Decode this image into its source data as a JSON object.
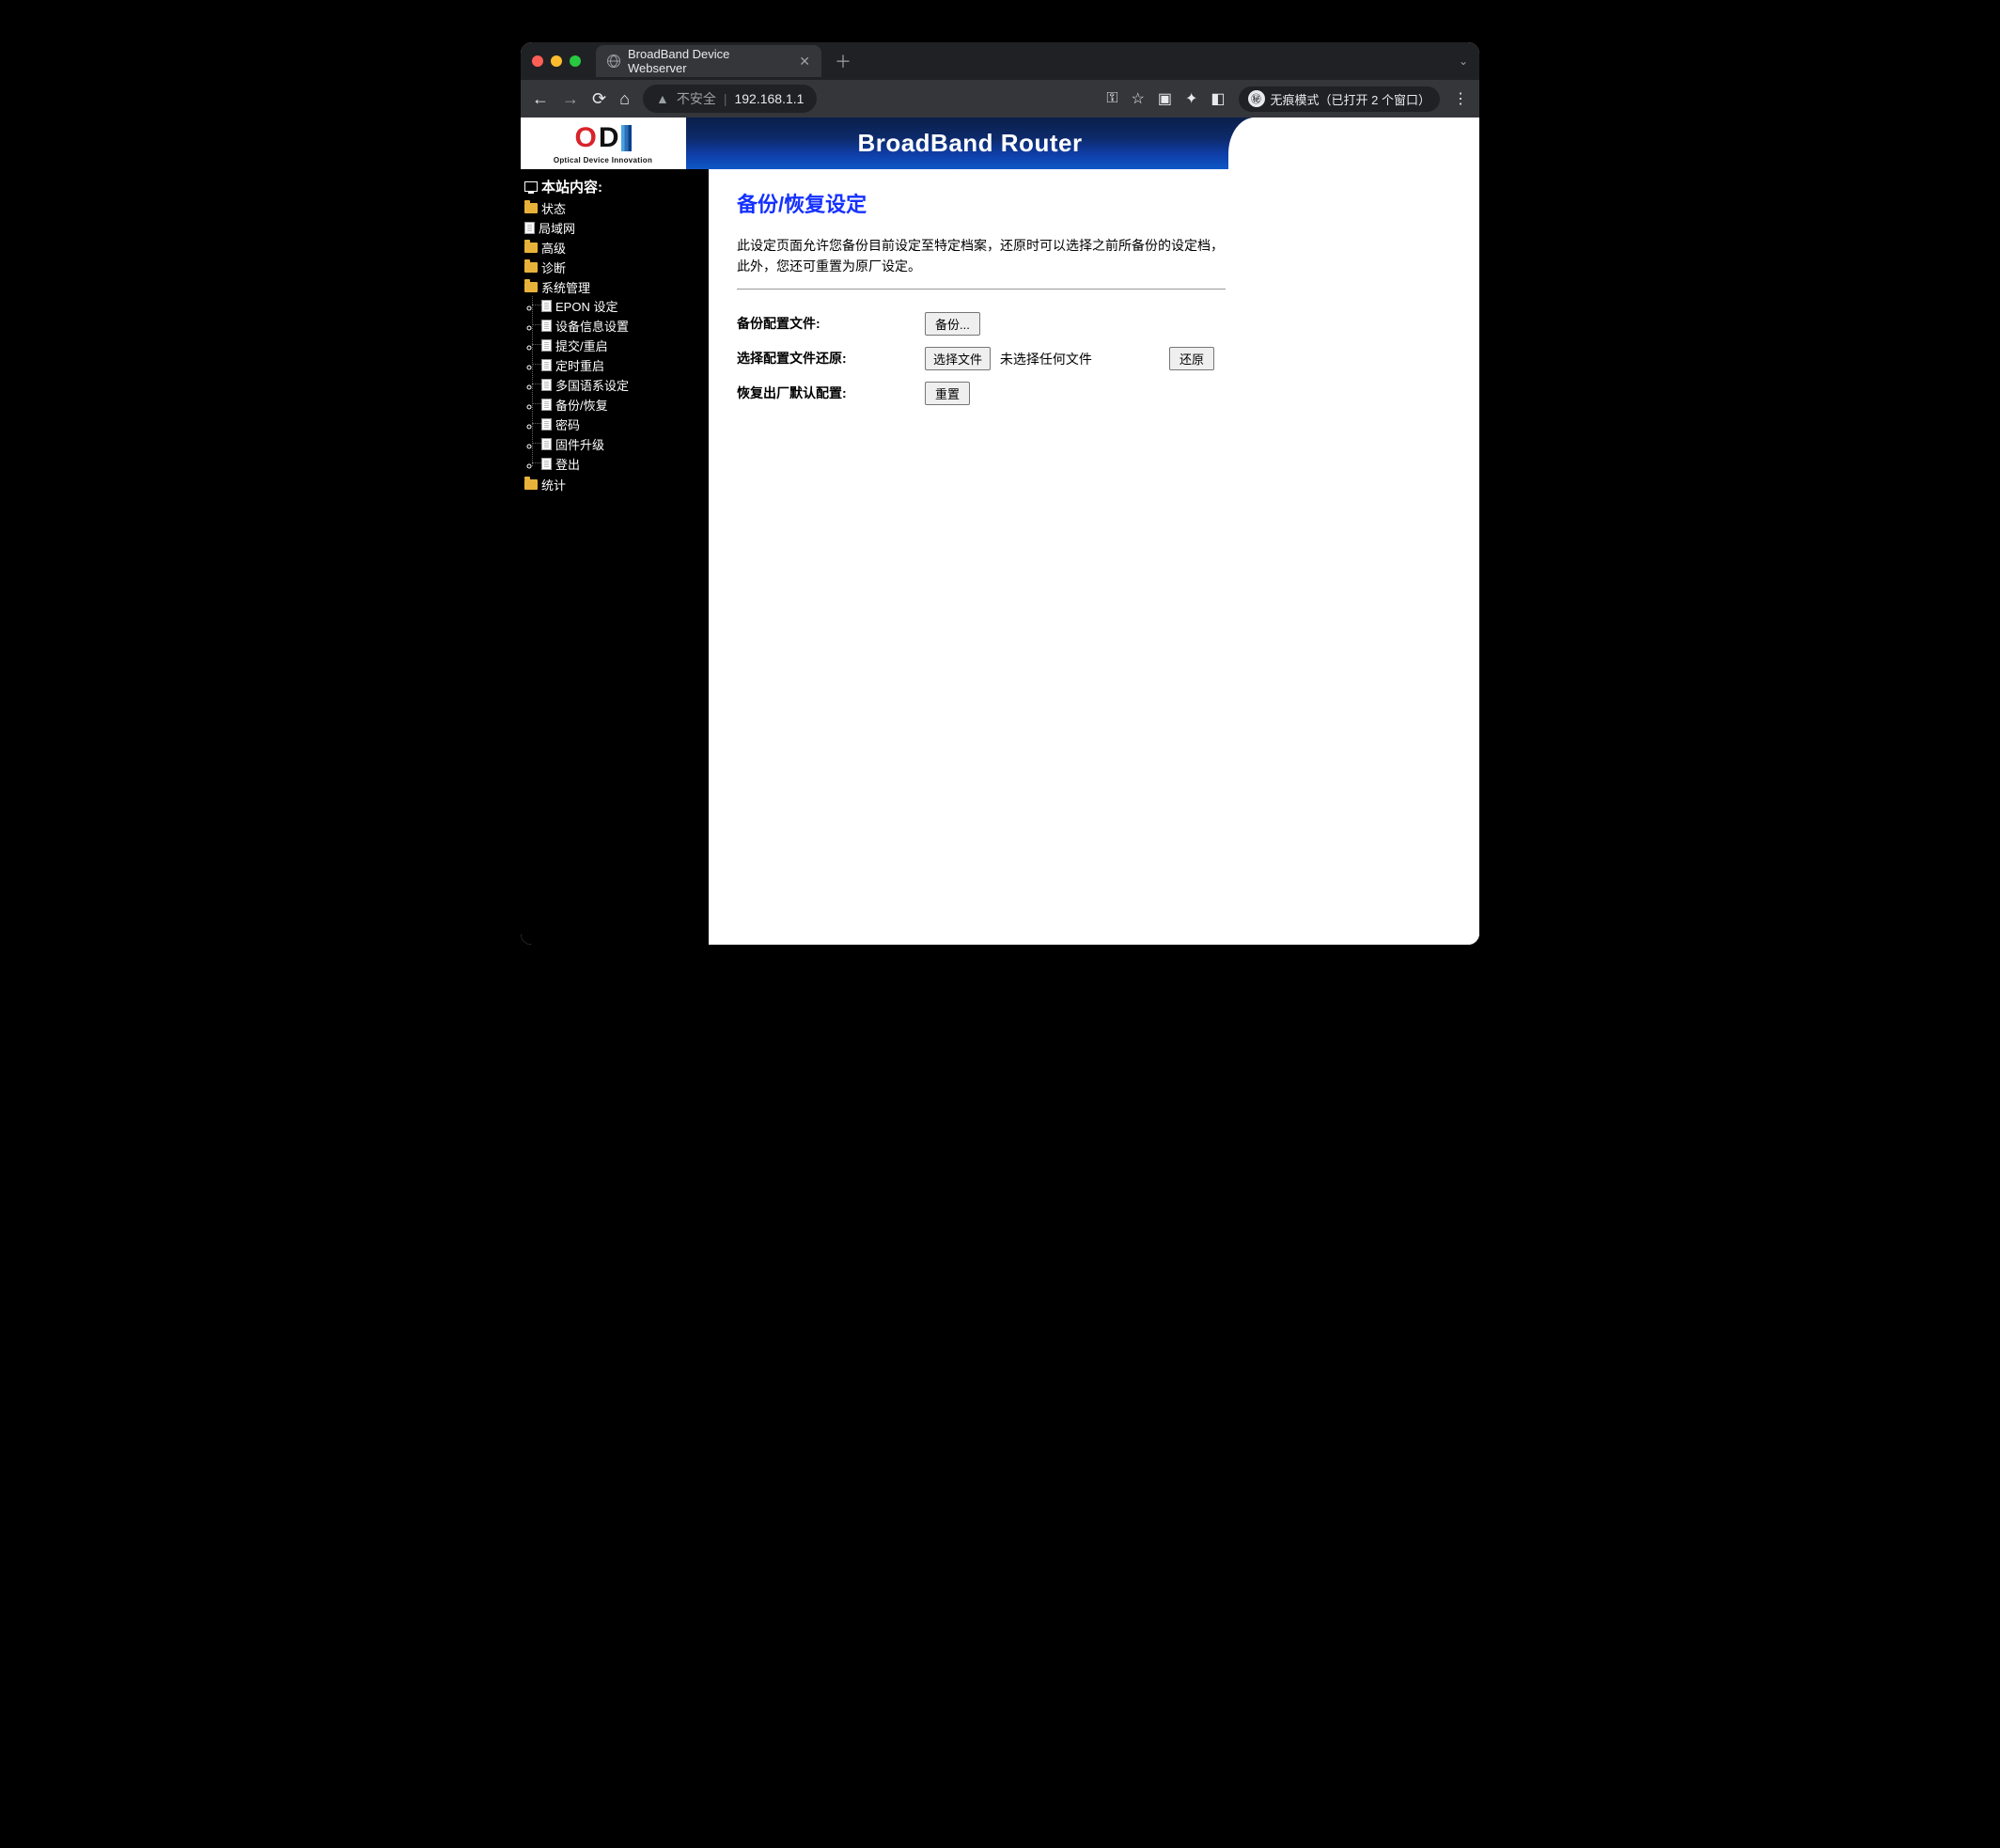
{
  "browser": {
    "tab_title": "BroadBand Device Webserver",
    "insecure_label": "不安全",
    "url": "192.168.1.1",
    "incognito_label": "无痕模式（已打开 2 个窗口）"
  },
  "banner": {
    "logo_sub": "Optical Device Innovation",
    "title": "BroadBand Router"
  },
  "sidebar": {
    "root": "本站内容:",
    "items": [
      {
        "type": "folder",
        "label": "状态"
      },
      {
        "type": "page",
        "label": "局域网"
      },
      {
        "type": "folder",
        "label": "高级"
      },
      {
        "type": "folder",
        "label": "诊断"
      },
      {
        "type": "folder",
        "label": "系统管理",
        "open": true,
        "children": [
          {
            "type": "page",
            "label": "EPON 设定"
          },
          {
            "type": "page",
            "label": "设备信息设置"
          },
          {
            "type": "page",
            "label": "提交/重启"
          },
          {
            "type": "page",
            "label": "定时重启"
          },
          {
            "type": "page",
            "label": "多国语系设定"
          },
          {
            "type": "page",
            "label": "备份/恢复"
          },
          {
            "type": "page",
            "label": "密码"
          },
          {
            "type": "page",
            "label": "固件升级"
          },
          {
            "type": "page",
            "label": "登出"
          }
        ]
      },
      {
        "type": "folder",
        "label": "统计"
      }
    ]
  },
  "content": {
    "heading": "备份/恢复设定",
    "intro": "此设定页面允许您备份目前设定至特定档案，还原时可以选择之前所备份的设定档，此外，您还可重置为原厂设定。",
    "rows": {
      "backup_label": "备份配置文件:",
      "backup_button": "备份...",
      "restore_label": "选择配置文件还原:",
      "choose_file_button": "选择文件",
      "no_file_text": "未选择任何文件",
      "restore_button": "还原",
      "reset_label": "恢复出厂默认配置:",
      "reset_button": "重置"
    }
  }
}
